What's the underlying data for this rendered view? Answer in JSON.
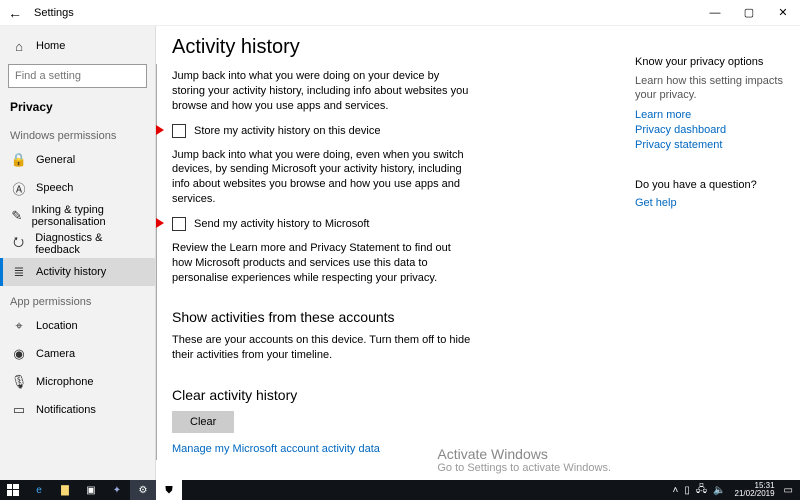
{
  "titlebar": {
    "back": "←",
    "title": "Settings",
    "min": "—",
    "max": "▢",
    "close": "✕"
  },
  "sidebar": {
    "home": "Home",
    "search_placeholder": "Find a setting",
    "current_section": "Privacy",
    "group_windows_perms": "Windows permissions",
    "items_win": [
      {
        "icon": "🔒",
        "label": "General"
      },
      {
        "icon": "Ⓐ",
        "label": "Speech"
      },
      {
        "icon": "✎",
        "label": "Inking & typing personalisation"
      },
      {
        "icon": "⭮",
        "label": "Diagnostics & feedback"
      },
      {
        "icon": "≣",
        "label": "Activity history"
      }
    ],
    "group_app_perms": "App permissions",
    "items_app": [
      {
        "icon": "⌖",
        "label": "Location"
      },
      {
        "icon": "◉",
        "label": "Camera"
      },
      {
        "icon": "🎙",
        "label": "Microphone"
      },
      {
        "icon": "▭",
        "label": "Notifications"
      }
    ]
  },
  "content": {
    "title": "Activity history",
    "desc1": "Jump back into what you were doing on your device by storing your activity history, including info about websites you browse and how you use apps and services.",
    "cb1": "Store my activity history on this device",
    "desc2": "Jump back into what you were doing, even when you switch devices, by sending Microsoft your activity history, including info about websites you browse and how you use apps and services.",
    "cb2": "Send my activity history to Microsoft",
    "desc3": "Review the Learn more and Privacy Statement to find out how Microsoft products and services use this data to personalise experiences while respecting your privacy.",
    "section_accounts": "Show activities from these accounts",
    "desc_accounts": "These are your accounts on this device. Turn them off to hide their activities from your timeline.",
    "section_clear": "Clear activity history",
    "clear_btn": "Clear",
    "manage_link": "Manage my Microsoft account activity data"
  },
  "rightcol": {
    "h1": "Know your privacy options",
    "sub1": "Learn how this setting impacts your privacy.",
    "links1": [
      "Learn more",
      "Privacy dashboard",
      "Privacy statement"
    ],
    "h2": "Do you have a question?",
    "link2": "Get help"
  },
  "watermark": {
    "l1": "Activate Windows",
    "l2": "Go to Settings to activate Windows."
  },
  "taskbar": {
    "time": "15:31",
    "date": "21/02/2019"
  }
}
